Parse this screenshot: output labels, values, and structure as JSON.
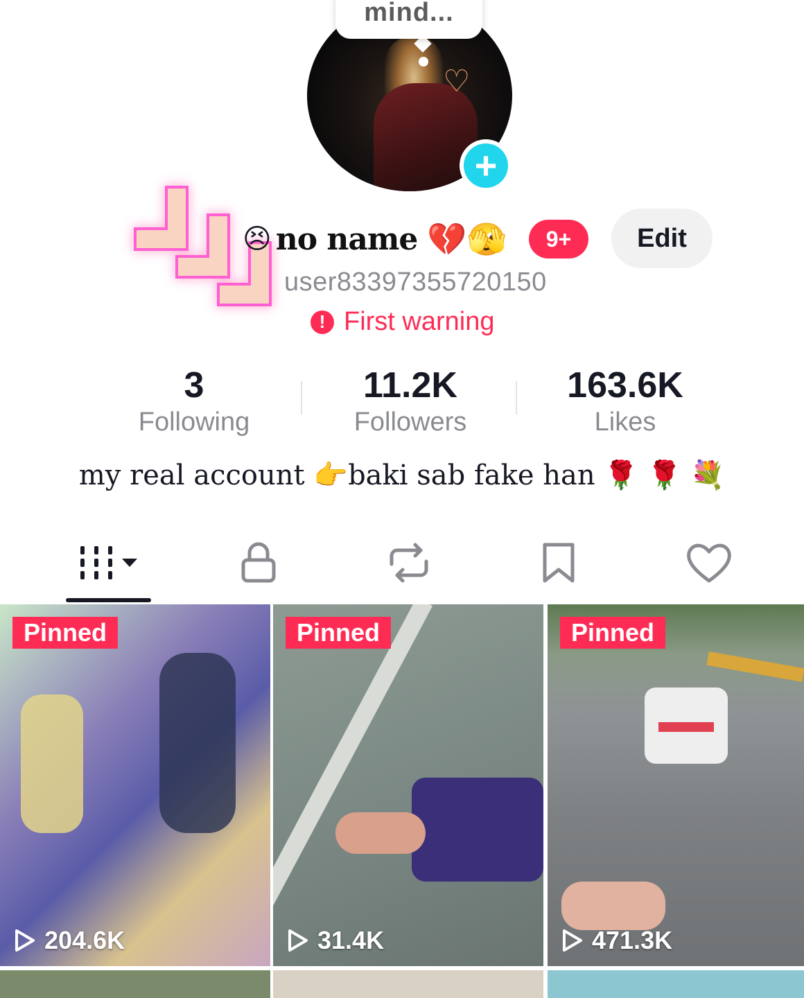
{
  "status_bubble": {
    "text": "mind..."
  },
  "profile": {
    "name_prefix_emoji": "😣",
    "name": "no name",
    "name_suffix_emoji": "💔🫣",
    "notification_badge": "9+",
    "edit_label": "Edit",
    "username": "user83397355720150",
    "warning_text": "First warning",
    "warning_icon": "!"
  },
  "stats": [
    {
      "value": "3",
      "label": "Following"
    },
    {
      "value": "11.2K",
      "label": "Followers"
    },
    {
      "value": "163.6K",
      "label": "Likes"
    }
  ],
  "bio": "my real account 👉baki sab fake han 🌹 🌹 💐",
  "tabs": [
    {
      "icon": "videos-grid-icon",
      "selected": true
    },
    {
      "icon": "lock-icon"
    },
    {
      "icon": "repost-icon"
    },
    {
      "icon": "bookmark-icon"
    },
    {
      "icon": "heart-icon"
    }
  ],
  "videos": [
    {
      "pinned_label": "Pinned",
      "views": "204.6K"
    },
    {
      "pinned_label": "Pinned",
      "views": "31.4K"
    },
    {
      "pinned_label": "Pinned",
      "views": "471.3K"
    }
  ],
  "colors": {
    "accent": "#fe2c55",
    "plus": "#20d5ec",
    "secondary_text": "#8a8b91"
  }
}
